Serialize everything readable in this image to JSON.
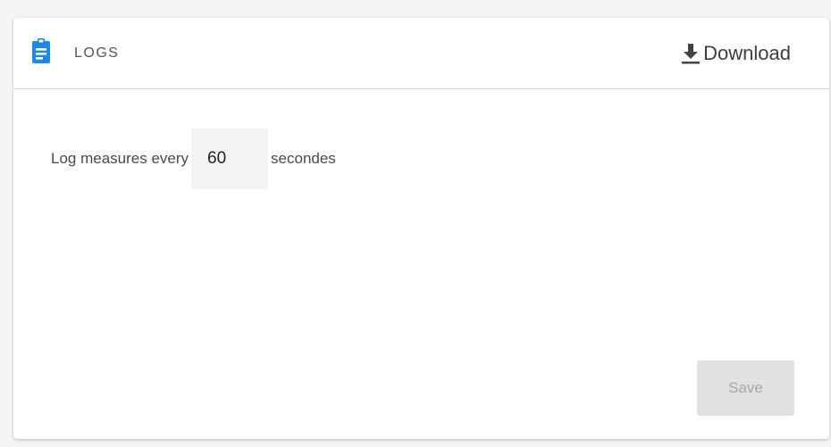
{
  "header": {
    "title": "LOGS",
    "icon": "clipboard-icon",
    "icon_color": "#1e88e5",
    "download": {
      "label": "Download",
      "icon": "download-icon"
    }
  },
  "log_settings": {
    "label_before": "Log measures every",
    "interval_value": "60",
    "label_after": "secondes"
  },
  "actions": {
    "save_label": "Save",
    "save_disabled": true
  }
}
